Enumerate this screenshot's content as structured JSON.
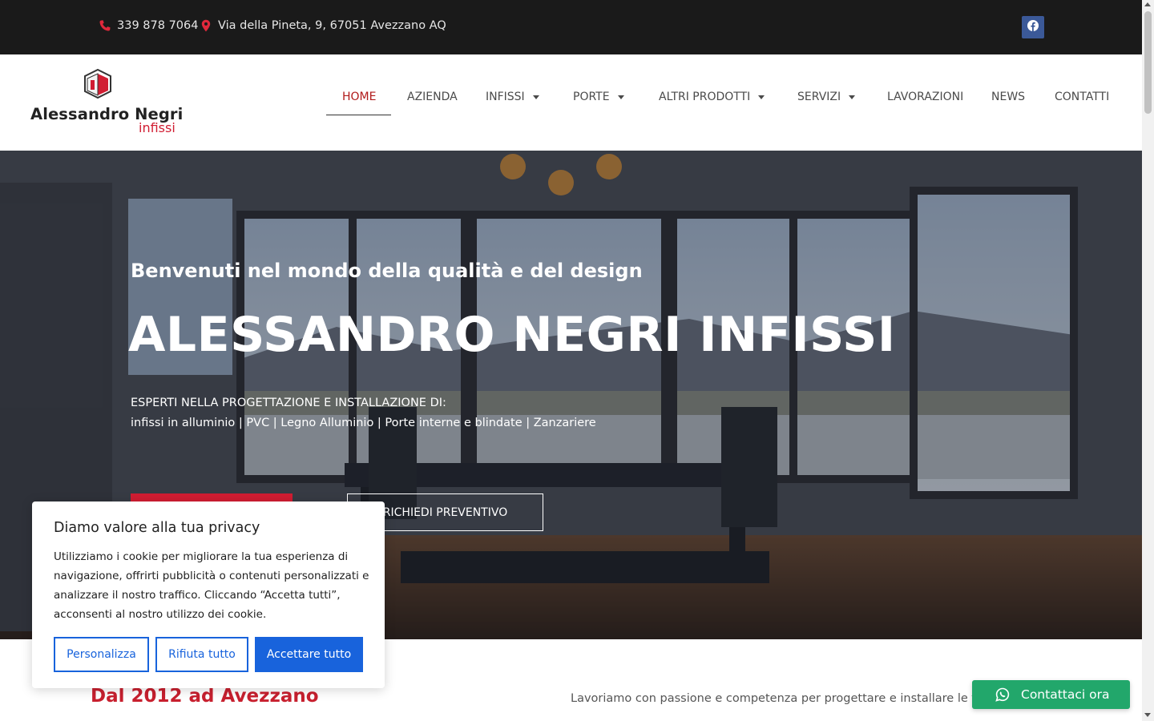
{
  "topbar": {
    "phone": "339 878 7064",
    "address": "Via della Pineta, 9, 67051 Avezzano AQ",
    "phone_icon": "phone-icon",
    "address_icon": "map-marker-icon",
    "social_icon": "facebook-icon"
  },
  "logo": {
    "brand": "Alessandro Negri",
    "sub": "infissi"
  },
  "nav": {
    "items": [
      {
        "label": "HOME",
        "active": true,
        "dropdown": false
      },
      {
        "label": "AZIENDA",
        "dropdown": false
      },
      {
        "label": "INFISSI",
        "dropdown": true
      },
      {
        "label": "PORTE",
        "dropdown": true
      },
      {
        "label": "ALTRI PRODOTTI",
        "dropdown": true
      },
      {
        "label": "SERVIZI",
        "dropdown": true
      },
      {
        "label": "LAVORAZIONI",
        "dropdown": false
      },
      {
        "label": "NEWS",
        "dropdown": false
      },
      {
        "label": "CONTATTI",
        "dropdown": false
      }
    ]
  },
  "hero": {
    "subtitle": "Benvenuti nel mondo della qualità e del design",
    "title": "ALESSANDRO NEGRI INFISSI",
    "line1": "ESPERTI NELLA PROGETTAZIONE E INSTALLAZIONE DI:",
    "line2": "infissi in alluminio | PVC | Legno Alluminio | Porte interne e blindate | Zanzariere",
    "quote_button": "RICHIEDI PREVENTIVO"
  },
  "intro": {
    "title": "Dal 2012 ad Avezzano",
    "text": "Lavoriamo con passione e competenza per progettare e installare le finestre"
  },
  "cookie": {
    "title": "Diamo valore alla tua privacy",
    "body": "Utilizziamo i cookie per migliorare la tua esperienza di navigazione, offrirti pubblicità o contenuti personalizzati e analizzare il nostro traffico. Cliccando “Accetta tutti”, acconsenti al nostro utilizzo dei cookie.",
    "customize": "Personalizza",
    "reject": "Rifiuta tutto",
    "accept": "Accettare tutto"
  },
  "whatsapp": {
    "label": "Contattaci ora",
    "icon": "whatsapp-icon"
  },
  "colors": {
    "brand_red": "#d11d32",
    "cookie_blue": "#1863dc",
    "whatsapp_green": "#22a76b",
    "topbar_bg": "#1a1a1a"
  }
}
